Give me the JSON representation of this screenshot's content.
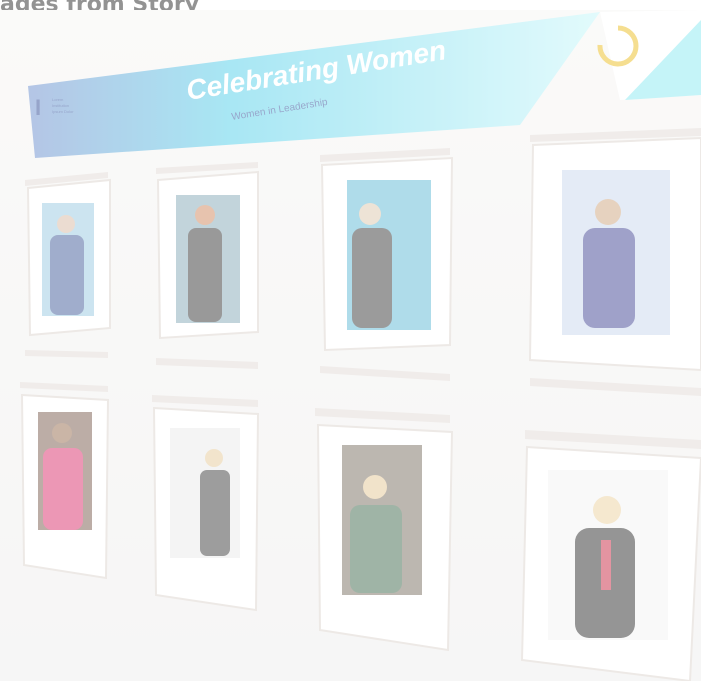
{
  "caption": {
    "top_text": "ages from Story"
  },
  "banner": {
    "title": "Celebrating Women",
    "subtitle": "Women in Leadership",
    "logo_text": [
      "Lorem",
      "Institution",
      "Ipsum Dolor"
    ],
    "colors": {
      "cyan": "#a8f2f6",
      "navy": "#17378a",
      "gold": "#e8b60a",
      "white": "#ffffff"
    }
  },
  "frames": [
    {
      "id": 1,
      "row": 1,
      "subject": "woman in blue blazer",
      "outfit": "#2e4a8e",
      "bg": "#8ec4de"
    },
    {
      "id": 2,
      "row": 1,
      "subject": "woman in black dress",
      "outfit": "#1d1d1d",
      "bg": "#78a0b0"
    },
    {
      "id": 3,
      "row": 1,
      "subject": "woman seated, dark top",
      "outfit": "#222222",
      "bg": "#4fb1d0"
    },
    {
      "id": 4,
      "row": 1,
      "subject": "woman in patterned dress",
      "outfit": "#2a2f88",
      "bg": "#c3d2ea"
    },
    {
      "id": 5,
      "row": 2,
      "subject": "woman in pink sweater",
      "outfit": "#d41a5c",
      "bg": "#6a4a3a"
    },
    {
      "id": 6,
      "row": 2,
      "subject": "woman standing, black outfit",
      "outfit": "#262626",
      "bg": "#e6e6e6"
    },
    {
      "id": 7,
      "row": 2,
      "subject": "woman in green blouse",
      "outfit": "#2b5a3a",
      "bg": "#6b5f50"
    },
    {
      "id": 8,
      "row": 2,
      "subject": "woman in black jacket, red top",
      "outfit": "#161616",
      "bg": "#f2f2f2"
    }
  ]
}
